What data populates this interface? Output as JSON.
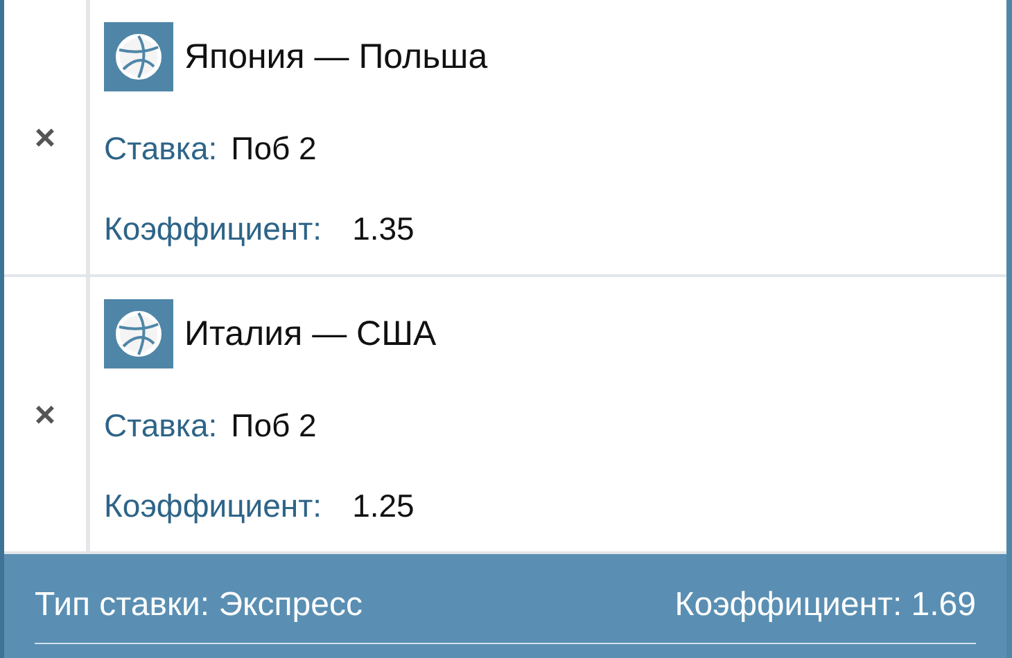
{
  "bets": [
    {
      "remove": "×",
      "match": "Япония — Польша",
      "bet_label": "Ставка:",
      "bet_value": "Поб 2",
      "odds_label": "Коэффициент:",
      "odds_value": "1.35"
    },
    {
      "remove": "×",
      "match": "Италия — США",
      "bet_label": "Ставка:",
      "bet_value": "Поб 2",
      "odds_label": "Коэффициент:",
      "odds_value": "1.25"
    }
  ],
  "footer": {
    "type_label": "Тип ставки: Экспресс",
    "total_odds": "Коэффициент: 1.69"
  }
}
